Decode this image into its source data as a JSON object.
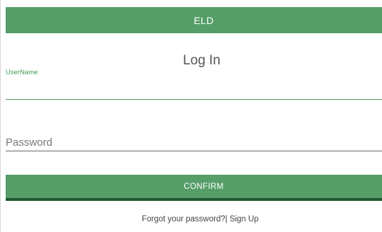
{
  "app_bar": {
    "title": "ELD"
  },
  "login": {
    "title": "Log In",
    "username_label": "UserName",
    "username_value": "",
    "password_placeholder": "Password",
    "password_value": "",
    "confirm_label": "CONFIRM",
    "forgot_password_label": "Forgot your password?",
    "separator": "|",
    "sign_up_label": "Sign Up"
  },
  "colors": {
    "primary": "#559e68",
    "primary_dark": "#1f5a2f",
    "accent_text": "#3f9a52"
  }
}
